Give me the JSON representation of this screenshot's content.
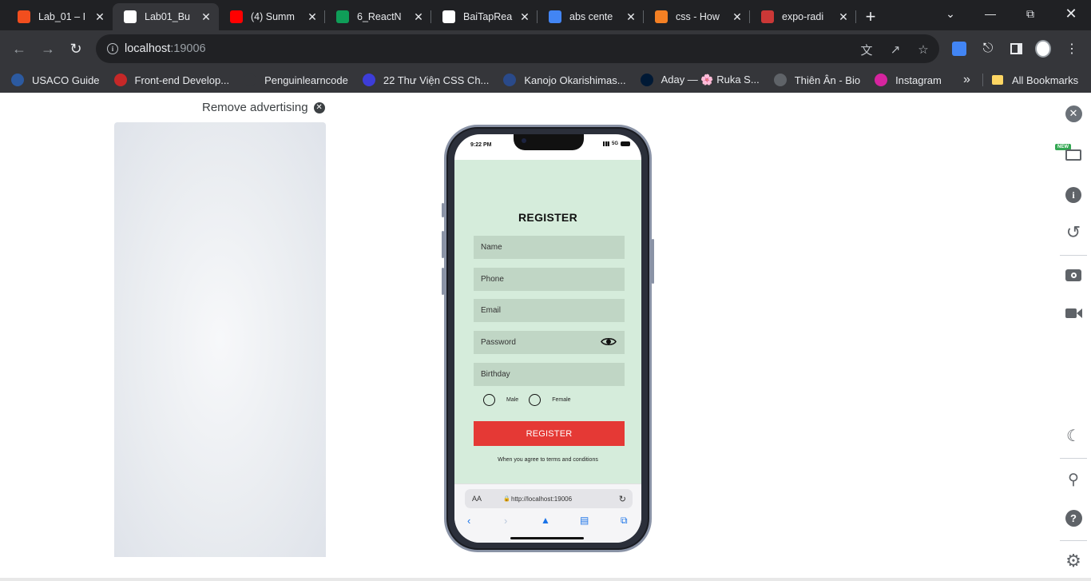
{
  "tabs": [
    {
      "title": "Lab_01 – I",
      "favicon": "figma-icon",
      "color": "#f24e1e"
    },
    {
      "title": "Lab01_Bu",
      "favicon": "wolf-icon",
      "color": "#ffffff"
    },
    {
      "title": "(4) Summ",
      "favicon": "youtube-icon",
      "color": "#ff0000"
    },
    {
      "title": "6_ReactN",
      "favicon": "sheets-plus-icon",
      "color": "#0f9d58"
    },
    {
      "title": "BaiTapRea",
      "favicon": "github-icon",
      "color": "#ffffff"
    },
    {
      "title": "abs cente",
      "favicon": "google-icon",
      "color": "#4285f4"
    },
    {
      "title": "css - How",
      "favicon": "stackoverflow-icon",
      "color": "#f48024"
    },
    {
      "title": "expo-radi",
      "favicon": "npm-icon",
      "color": "#cb3837"
    }
  ],
  "active_tab_index": 1,
  "address": {
    "host": "localhost",
    "port": ":19006"
  },
  "bookmarks": [
    {
      "label": "USACO Guide",
      "icon": "usaco-icon",
      "color": "#2c5aa0"
    },
    {
      "label": "Front-end Develop...",
      "icon": "m-icon",
      "color": "#c62828"
    },
    {
      "label": "Penguinlearncode",
      "icon": "penguin-icon",
      "color": "#35363a"
    },
    {
      "label": "22 Thư Viện CSS Ch...",
      "icon": "n-icon",
      "color": "#3d3dd8"
    },
    {
      "label": "Kanojo Okarishimas...",
      "icon": "rc-icon",
      "color": "#2a4a8a"
    },
    {
      "label": "Aday — 🌸 Ruka S...",
      "icon": "tumblr-icon",
      "color": "#001935"
    },
    {
      "label": "Thiên Ân - Bio",
      "icon": "globe-icon",
      "color": "#5f6368"
    },
    {
      "label": "Instagram",
      "icon": "instagram-icon",
      "color": "#d6249f"
    }
  ],
  "bookmarks_more": "»",
  "all_bookmarks": "All Bookmarks",
  "ad": {
    "remove_label": "Remove advertising"
  },
  "phone": {
    "time": "9:22 PM",
    "network": "5G",
    "title": "REGISTER",
    "fields": [
      "Name",
      "Phone",
      "Email",
      "Password",
      "Birthday"
    ],
    "gender_options": [
      "Male",
      "Female"
    ],
    "register_button": "REGISTER",
    "terms": "When you agree to terms and conditions",
    "safari_aa": "AA",
    "safari_url": "http://localhost:19006"
  },
  "side_panel": {
    "new_badge": "NEW"
  }
}
